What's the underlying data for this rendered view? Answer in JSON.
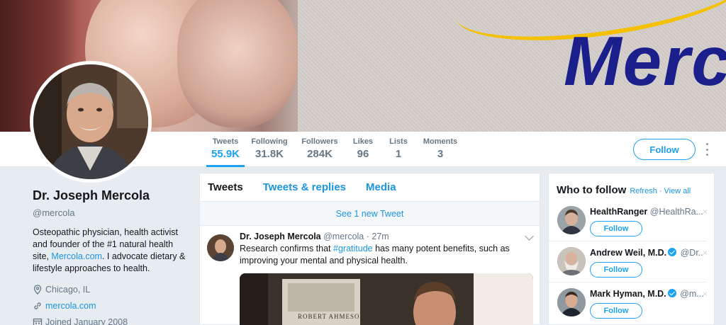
{
  "banner": {
    "brand_text": "Merc"
  },
  "nav": {
    "stats": [
      {
        "label": "Tweets",
        "value": "55.9K"
      },
      {
        "label": "Following",
        "value": "31.8K"
      },
      {
        "label": "Followers",
        "value": "284K"
      },
      {
        "label": "Likes",
        "value": "96"
      },
      {
        "label": "Lists",
        "value": "1"
      },
      {
        "label": "Moments",
        "value": "3"
      }
    ],
    "follow_label": "Follow"
  },
  "profile": {
    "name": "Dr. Joseph Mercola",
    "handle": "@mercola",
    "bio_part1": "Osteopathic physician, health activist and founder of the #1 natural health site, ",
    "bio_link": "Mercola.com",
    "bio_part2": ". I advocate dietary & lifestyle approaches to health.",
    "location": "Chicago, IL",
    "website": "mercola.com",
    "joined": "Joined January 2008"
  },
  "timeline": {
    "tabs": [
      "Tweets",
      "Tweets & replies",
      "Media"
    ],
    "new_tweets": "See 1 new Tweet",
    "tweet": {
      "name": "Dr. Joseph Mercola",
      "handle": "@mercola",
      "time": "· 27m",
      "text_before": "Research confirms that ",
      "hashtag": "#gratitude",
      "text_after": " has many potent benefits, such as improving your mental and physical health.",
      "media_caption": "ROBERT AHMESON"
    }
  },
  "who_to_follow": {
    "title": "Who to follow",
    "refresh": "Refresh",
    "separator": "·",
    "view_all": "View all",
    "suggestions": [
      {
        "name": "HealthRanger",
        "handle": "@HealthRa...",
        "verified": false,
        "button": "Follow",
        "dismiss": "×"
      },
      {
        "name": "Andrew Weil, M.D.",
        "handle": "@Dr...",
        "verified": true,
        "button": "Follow",
        "dismiss": "×"
      },
      {
        "name": "Mark Hyman, M.D.",
        "handle": "@m...",
        "verified": true,
        "button": "Follow",
        "dismiss": "×"
      }
    ]
  },
  "colors": {
    "accent": "#1da1f2",
    "link": "#1b95e0",
    "brand_blue": "#1a1f8c",
    "brand_yellow": "#f5c000"
  }
}
